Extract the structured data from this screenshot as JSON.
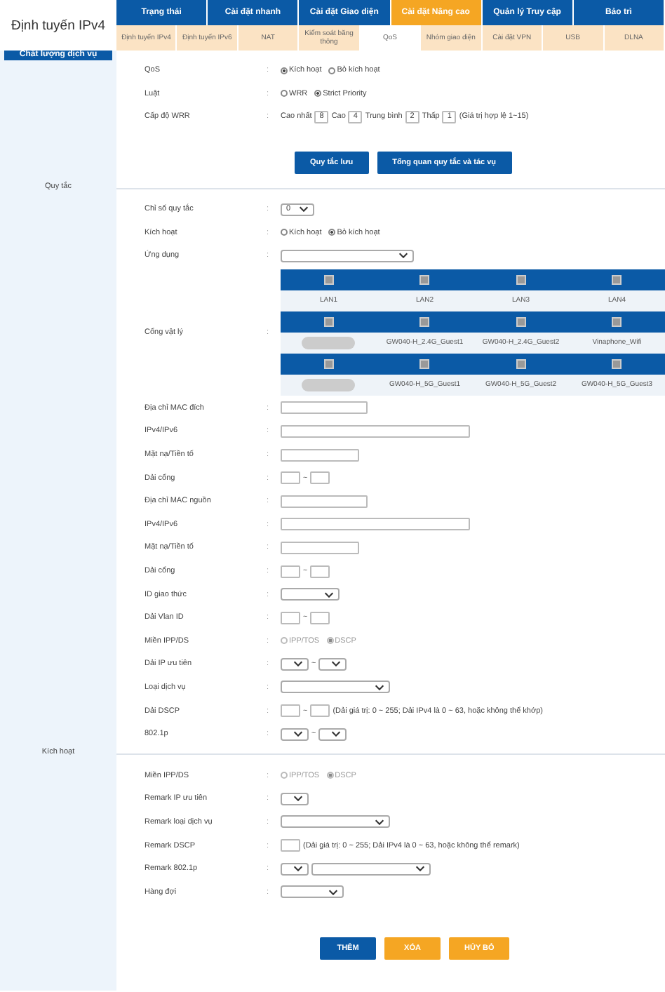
{
  "header": {
    "title": "Định tuyến IPv4",
    "section_title": "Chất lượng dịch vụ",
    "top_tabs": [
      {
        "label": "Trạng thái",
        "selected": false
      },
      {
        "label": "Cài đặt nhanh",
        "selected": false
      },
      {
        "label": "Cài đặt Giao diện",
        "selected": false
      },
      {
        "label": "Cài đặt Nâng cao",
        "selected": true
      },
      {
        "label": "Quản lý Truy cập",
        "selected": false
      },
      {
        "label": "Bảo trì",
        "selected": false
      }
    ],
    "sub_tabs": [
      {
        "label": "Định tuyến IPv4",
        "selected": false
      },
      {
        "label": "Định tuyến IPv6",
        "selected": false
      },
      {
        "label": "NAT",
        "selected": false
      },
      {
        "label": "Kiểm soát băng thông",
        "selected": false
      },
      {
        "label": "QoS",
        "selected": true
      },
      {
        "label": "Nhóm giao diện",
        "selected": false
      },
      {
        "label": "Cài đặt VPN",
        "selected": false
      },
      {
        "label": "USB",
        "selected": false
      },
      {
        "label": "DLNA",
        "selected": false
      }
    ]
  },
  "sections": [
    {
      "side_label": "Quy tắc",
      "rows": [
        {
          "kind": "radio",
          "label": "QoS",
          "colon": ":",
          "options": [
            {
              "label": "Kích hoạt",
              "selected": true
            },
            {
              "label": "Bỏ kích hoạt",
              "selected": false
            }
          ]
        },
        {
          "kind": "radio",
          "label": "Luật",
          "colon": ":",
          "options": [
            {
              "label": "WRR",
              "selected": false
            },
            {
              "label": "Strict Priority",
              "selected": true
            }
          ]
        },
        {
          "kind": "wrr",
          "label": "Cấp độ WRR",
          "colon": ":",
          "fields": [
            {
              "label": "Cao nhất",
              "value": "8"
            },
            {
              "label": "Cao",
              "value": "4"
            },
            {
              "label": "Trung bình",
              "value": "2"
            },
            {
              "label": "Thấp",
              "value": "1"
            }
          ],
          "note": "(Giá trị hợp lệ 1~15)"
        }
      ],
      "buttons": [
        {
          "label": "Quy tắc lưu",
          "kind": "primary"
        },
        {
          "label": "Tổng quan quy tắc và tác vụ",
          "kind": "primary"
        }
      ]
    },
    {
      "side_label": "Kích hoạt",
      "rows": [
        {
          "kind": "select",
          "label": "Chỉ số quy tắc",
          "colon": ":",
          "value": "0"
        },
        {
          "kind": "radio",
          "label": "Kích hoạt",
          "colon": ":",
          "options": [
            {
              "label": "Kích hoạt",
              "selected": false
            },
            {
              "label": "Bỏ kích hoạt",
              "selected": true
            }
          ]
        },
        {
          "kind": "select",
          "label": "Ứng dụng",
          "colon": ":"
        },
        {
          "kind": "ports",
          "label": "Cổng vật lý",
          "colon": ":",
          "groups": [
            [
              {
                "kind": "port",
                "label": "LAN1",
                "checked": false
              },
              {
                "kind": "port",
                "label": "LAN2",
                "checked": false
              },
              {
                "kind": "port",
                "label": "LAN3",
                "checked": false
              },
              {
                "kind": "port",
                "label": "LAN4",
                "checked": false
              }
            ],
            [
              {
                "kind": "redacted",
                "checked": false
              },
              {
                "kind": "port",
                "label": "GW040-H_2.4G_Guest1",
                "checked": false
              },
              {
                "kind": "port",
                "label": "GW040-H_2.4G_Guest2",
                "checked": false
              },
              {
                "kind": "port",
                "label": "Vinaphone_Wifi",
                "checked": false
              }
            ],
            [
              {
                "kind": "redacted",
                "checked": false
              },
              {
                "kind": "port",
                "label": "GW040-H_5G_Guest1",
                "checked": false
              },
              {
                "kind": "port",
                "label": "GW040-H_5G_Guest2",
                "checked": false
              },
              {
                "kind": "port",
                "label": "GW040-H_5G_Guest3",
                "checked": false
              }
            ]
          ]
        },
        {
          "kind": "text",
          "label": "Địa chỉ MAC đích",
          "colon": ":"
        },
        {
          "kind": "text",
          "label": "IPv4/IPv6",
          "colon": ":"
        },
        {
          "kind": "text",
          "label": "Mặt nạ/Tiền tố",
          "colon": ":"
        },
        {
          "kind": "range",
          "label": "Dải cổng",
          "colon": ":",
          "separator": "~"
        },
        {
          "kind": "text",
          "label": "Địa chỉ MAC nguồn",
          "colon": ":"
        },
        {
          "kind": "text",
          "label": "IPv4/IPv6",
          "colon": ":"
        },
        {
          "kind": "text",
          "label": "Mặt nạ/Tiền tố",
          "colon": ":"
        },
        {
          "kind": "range",
          "label": "Dải cổng",
          "colon": ":",
          "separator": "~"
        },
        {
          "kind": "select",
          "label": "ID giao thức",
          "colon": ":"
        },
        {
          "kind": "range",
          "label": "Dải Vlan ID",
          "colon": ":",
          "separator": "~"
        },
        {
          "kind": "radio",
          "label": "Miền IPP/DS",
          "colon": ":",
          "disabled": true,
          "options": [
            {
              "label": "IPP/TOS",
              "selected": false
            },
            {
              "label": "DSCP",
              "selected": true
            }
          ]
        },
        {
          "kind": "range-select",
          "label": "Dải IP ưu tiên",
          "colon": ":",
          "separator": "~"
        },
        {
          "kind": "select",
          "label": "Loại dịch vụ",
          "colon": ":"
        },
        {
          "kind": "range",
          "label": "Dải DSCP",
          "colon": ":",
          "separator": "~",
          "note": "(Dải giá trị: 0 ~ 255; Dải IPv4 là 0 ~ 63, hoặc không thể khớp)"
        },
        {
          "kind": "range-select",
          "label": "802.1p",
          "colon": ":",
          "separator": "~"
        }
      ]
    },
    {
      "rows": [
        {
          "kind": "radio",
          "label": "Miền IPP/DS",
          "colon": ":",
          "disabled": true,
          "options": [
            {
              "label": "IPP/TOS",
              "selected": false
            },
            {
              "label": "DSCP",
              "selected": true
            }
          ]
        },
        {
          "kind": "select",
          "label": "Remark IP ưu tiên",
          "colon": ":"
        },
        {
          "kind": "select",
          "label": "Remark loại dịch vụ",
          "colon": ":"
        },
        {
          "kind": "text",
          "label": "Remark DSCP",
          "colon": ":",
          "note": "(Dải giá trị: 0 ~ 255; Dải IPv4 là 0 ~ 63, hoặc không thể remark)"
        },
        {
          "kind": "select-pair",
          "label": "Remark 802.1p",
          "colon": ":"
        },
        {
          "kind": "select",
          "label": "Hàng đợi",
          "colon": ":"
        }
      ],
      "buttons": [
        {
          "label": "THÊM",
          "kind": "primary"
        },
        {
          "label": "XÓA",
          "kind": "warning"
        },
        {
          "label": "HỦY BỎ",
          "kind": "warning"
        }
      ]
    }
  ]
}
